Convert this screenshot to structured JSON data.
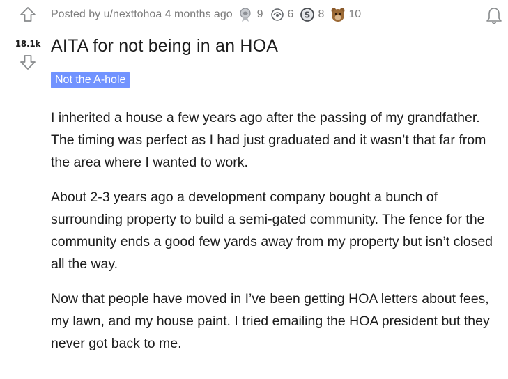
{
  "post": {
    "score": "18.1k",
    "meta": {
      "posted_by": "Posted by u/nexttohoa 4 months ago"
    },
    "awards": [
      {
        "icon": "silver-award-icon",
        "count": "9"
      },
      {
        "icon": "helpful-award-icon",
        "count": "6"
      },
      {
        "icon": "coin-award-icon",
        "count": "8"
      },
      {
        "icon": "bear-award-icon",
        "count": "10"
      }
    ],
    "title": "AITA for not being in an HOA",
    "flair": "Not the A-hole",
    "paragraphs": [
      "I inherited a house a few years ago after the passing of my grandfather. The timing was perfect as I had just graduated and it wasn’t that far from the area where I wanted to work.",
      "About 2-3 years ago a development company bought a bunch of surrounding property to build a semi-gated community. The fence for the community ends a good few yards away from my property but isn’t closed all the way.",
      "Now that people have moved in I’ve been getting HOA letters about fees, my lawn, and my house paint. I tried emailing the HOA president but they never got back to me."
    ]
  },
  "colors": {
    "flair_bg": "#7193ff",
    "meta_text": "#7c7c7c",
    "body_text": "#1c1c1c"
  }
}
